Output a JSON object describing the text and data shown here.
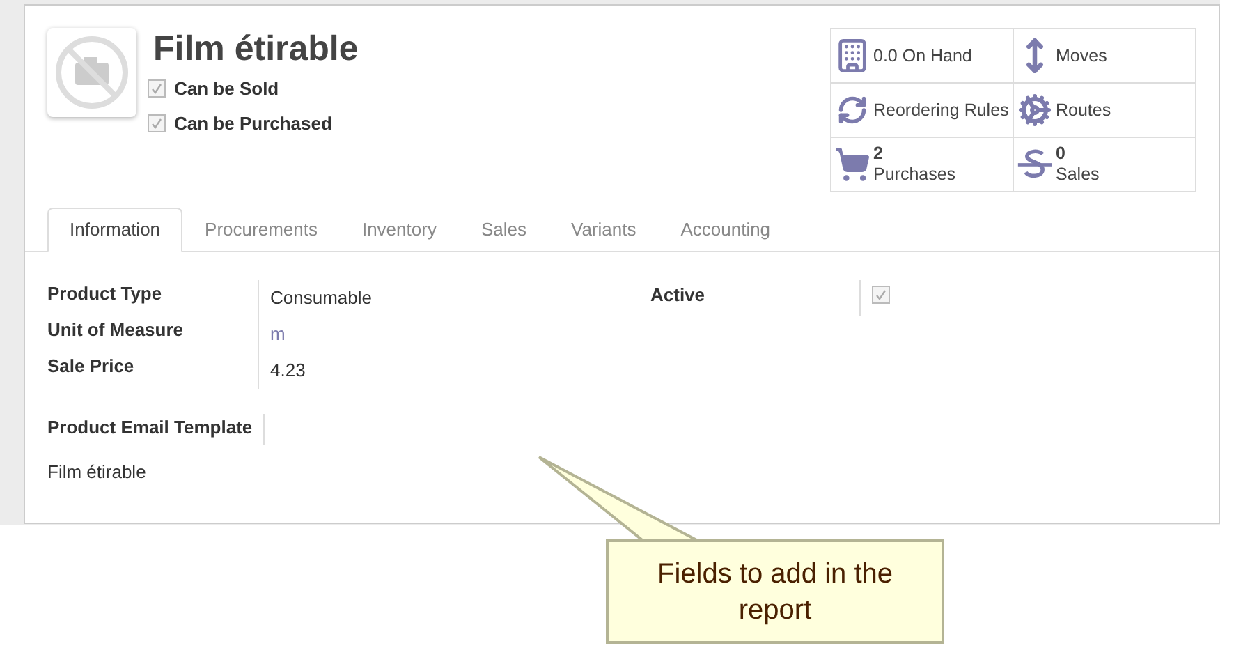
{
  "product": {
    "name": "Film étirable"
  },
  "flags": [
    {
      "label": "Can be Sold",
      "checked": true
    },
    {
      "label": "Can be Purchased",
      "checked": true
    }
  ],
  "stat_buttons": [
    {
      "label": "0.0 On Hand"
    },
    {
      "label": "Moves"
    },
    {
      "label": "Reordering Rules"
    },
    {
      "label": "Routes"
    },
    {
      "count": "2",
      "label": "Purchases"
    },
    {
      "count": "0",
      "label": "Sales"
    }
  ],
  "tabs": [
    {
      "label": "Information",
      "selected": true
    },
    {
      "label": "Procurements",
      "selected": false
    },
    {
      "label": "Inventory",
      "selected": false
    },
    {
      "label": "Sales",
      "selected": false
    },
    {
      "label": "Variants",
      "selected": false
    },
    {
      "label": "Accounting",
      "selected": false
    }
  ],
  "fields": [
    {
      "label": "Product Type",
      "value": "Consumable",
      "kind": "text"
    },
    {
      "label": "Unit of Measure",
      "value": "m",
      "kind": "link"
    },
    {
      "label": "Sale Price",
      "value": "4.23",
      "kind": "text"
    }
  ],
  "active": {
    "label": "Active",
    "checked": true
  },
  "email_template": {
    "label": "Product Email Template",
    "value": "Film étirable"
  },
  "callout": {
    "text": "Fields to add in the report"
  }
}
